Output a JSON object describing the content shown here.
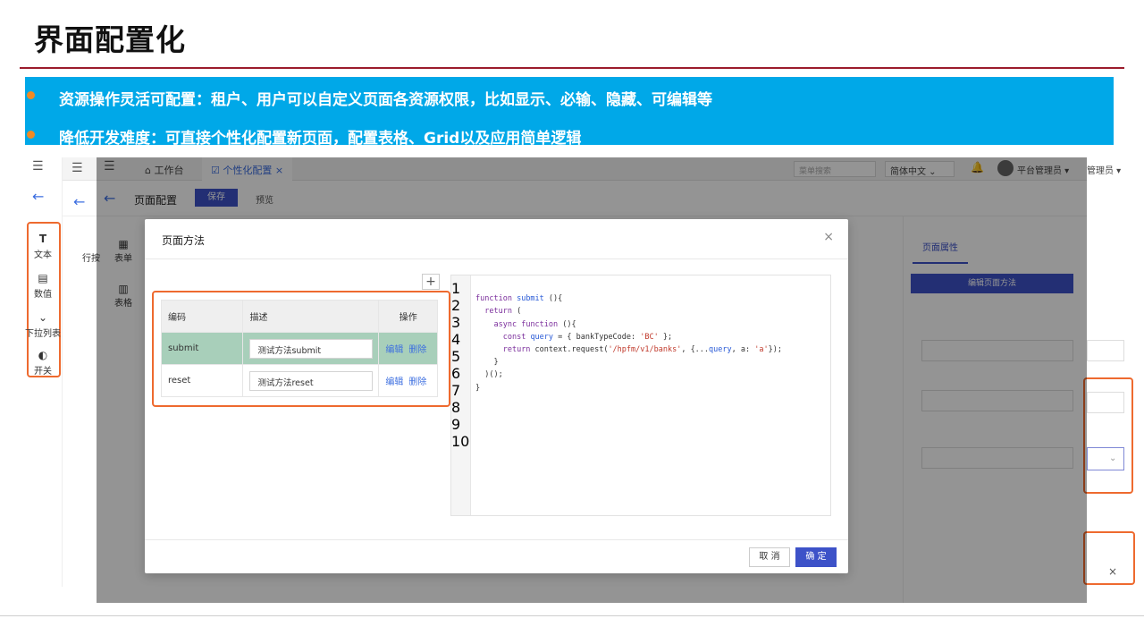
{
  "slide": {
    "title": "界面配置化",
    "bullets": [
      "资源操作灵活可配置：租户、用户可以自定义页面各资源权限，比如显示、必输、隐藏、可编辑等",
      "降低开发难度：可直接个性化配置新页面，配置表格、Grid以及应用简单逻辑"
    ],
    "accent_color": "#9b1c2c",
    "banner_color": "#00a8e8"
  },
  "app": {
    "tabs": {
      "home": "工作台",
      "active": "个性化配置"
    },
    "search_placeholder": "菜单搜索",
    "language": "简体中文",
    "user": "平台管理员",
    "user_cut": "管理员",
    "page_title": "页面配置",
    "save": "保存",
    "preview": "预览",
    "components": [
      {
        "label": "文本",
        "icon": "text-icon"
      },
      {
        "label": "数值",
        "icon": "number-icon"
      },
      {
        "label": "下拉列表",
        "icon": "dropdown-icon"
      },
      {
        "label": "开关",
        "icon": "switch-icon"
      }
    ],
    "side_tools": [
      "表单",
      "表格"
    ],
    "row_btn": "行按",
    "right_panel": {
      "tab": "页面属性",
      "edit_button": "编辑页面方法"
    }
  },
  "modal": {
    "title": "页面方法",
    "columns": [
      "编码",
      "描述",
      "操作"
    ],
    "rows": [
      {
        "code": "submit",
        "desc": "测试方法submit",
        "edit": "编辑",
        "delete": "删除"
      },
      {
        "code": "reset",
        "desc": "测试方法reset",
        "edit": "编辑",
        "delete": "删除"
      }
    ],
    "cancel": "取 消",
    "confirm": "确 定",
    "code_lines": [
      "",
      "function submit (){",
      "  return (",
      "    async function (){",
      "      const query = { bankTypeCode: 'BC' };",
      "      return context.request('/hpfm/v1/banks', {...query, a: 'a'});",
      "    }",
      "  )();",
      "}",
      ""
    ]
  }
}
